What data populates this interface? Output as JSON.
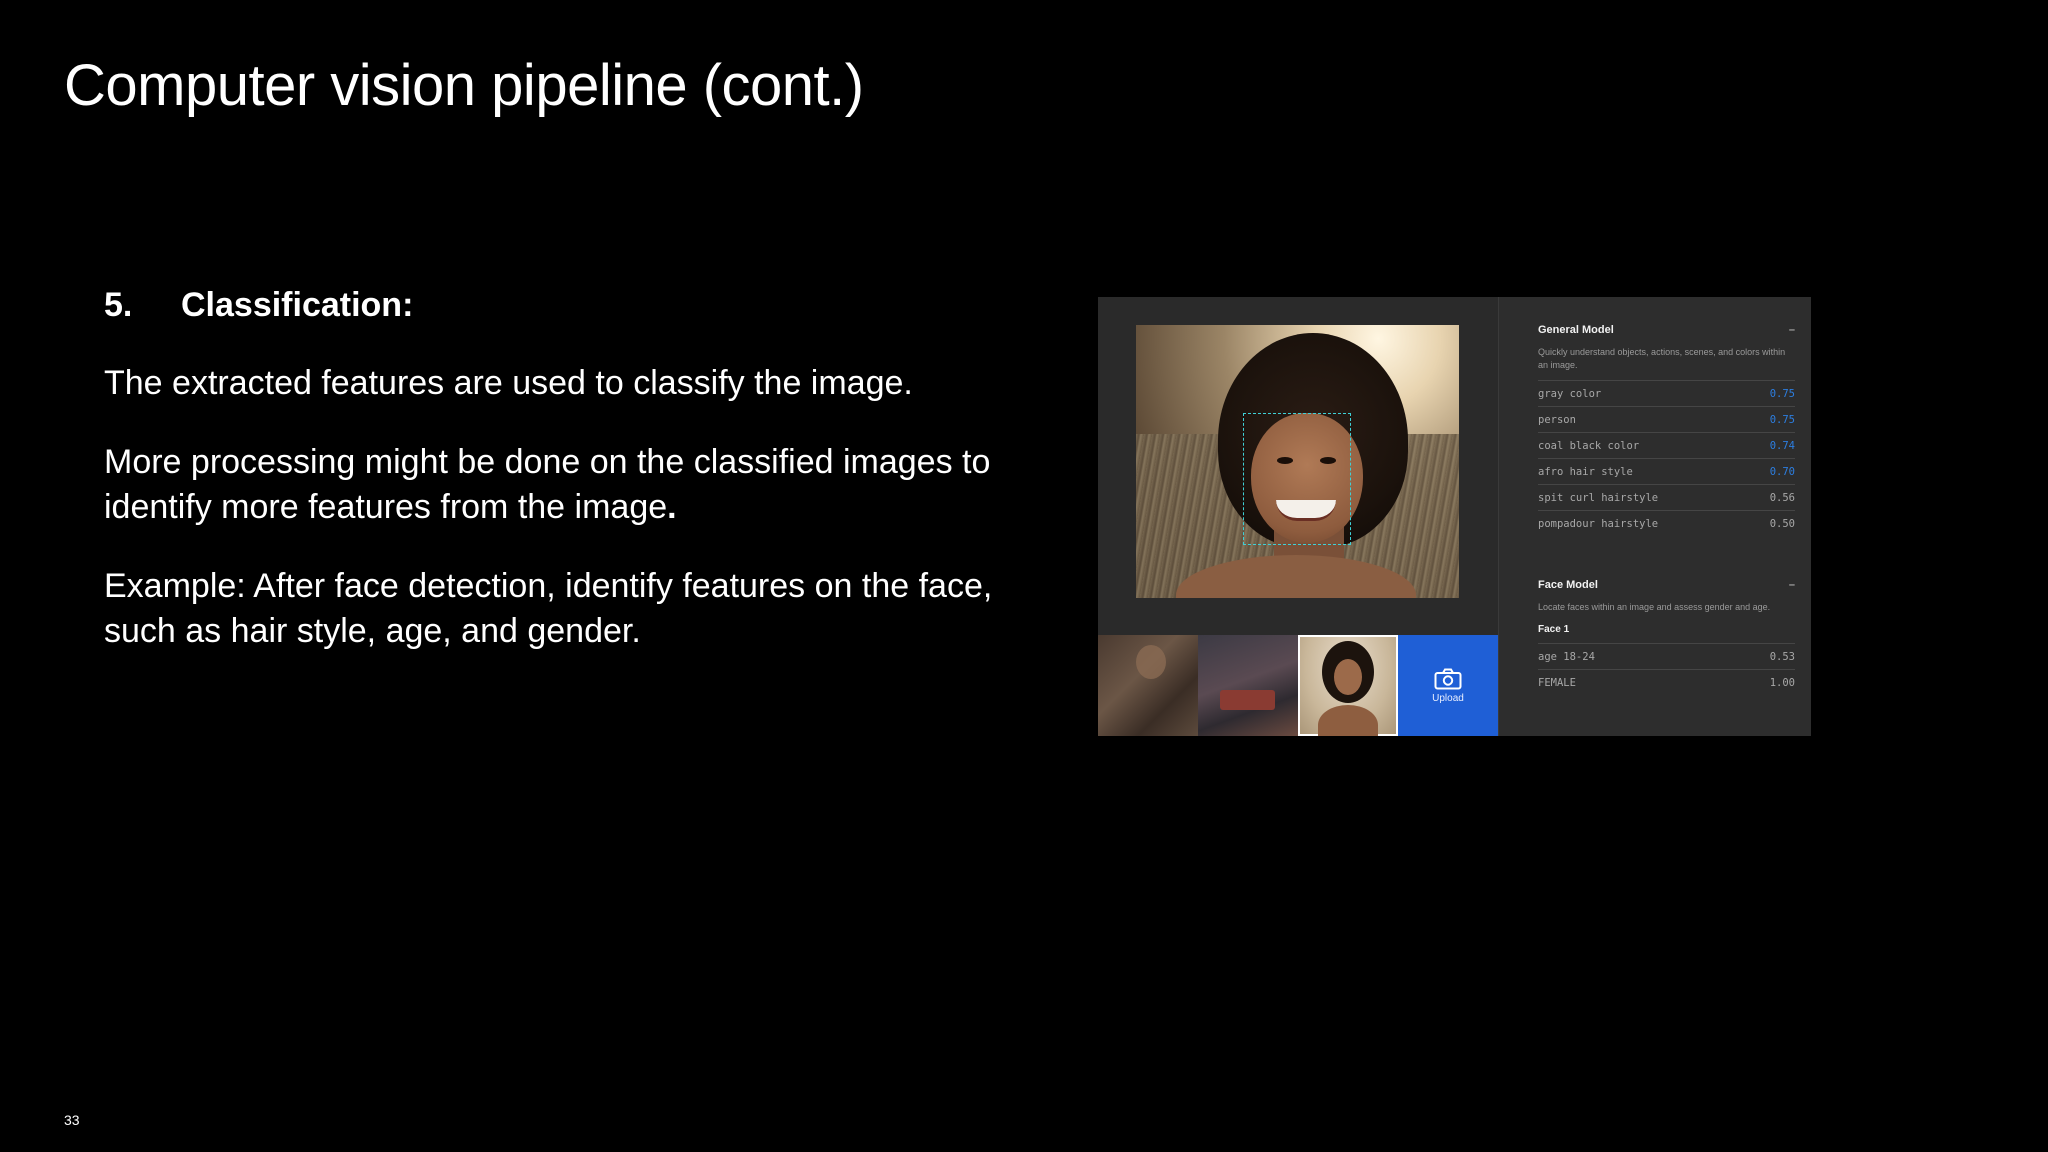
{
  "slide": {
    "title": "Computer vision pipeline (cont.)",
    "page_number": "33"
  },
  "content": {
    "step_number": "5.",
    "step_title": "Classification:",
    "para1": "The extracted features are used to classify the image.",
    "para2": "More processing might be done on the classified images to identify more features from the image",
    "para2_end": ".",
    "para3": "Example: After face detection, identify features on the face, such as hair style, age, and gender."
  },
  "demo": {
    "upload_label": "Upload",
    "upload_icon": "camera-icon",
    "accent_color": "#1f5fd6",
    "highlight_color": "#2d7ee0",
    "face_box_color": "#3fd0d6",
    "general_model": {
      "title": "General Model",
      "collapse": "–",
      "description": "Quickly understand objects, actions, scenes, and colors within an image.",
      "rows": [
        {
          "label": "gray color",
          "value": "0.75",
          "highlight": true
        },
        {
          "label": "person",
          "value": "0.75",
          "highlight": true
        },
        {
          "label": "coal black color",
          "value": "0.74",
          "highlight": true
        },
        {
          "label": "afro hair style",
          "value": "0.70",
          "highlight": true
        },
        {
          "label": "spit curl hairstyle",
          "value": "0.56",
          "highlight": false
        },
        {
          "label": "pompadour hairstyle",
          "value": "0.50",
          "highlight": false
        }
      ]
    },
    "face_model": {
      "title": "Face Model",
      "collapse": "–",
      "description": "Locate faces within an image and assess gender and age.",
      "face_label": "Face 1",
      "rows": [
        {
          "label": "age 18-24",
          "value": "0.53"
        },
        {
          "label": "FEMALE",
          "value": "1.00"
        }
      ]
    }
  }
}
